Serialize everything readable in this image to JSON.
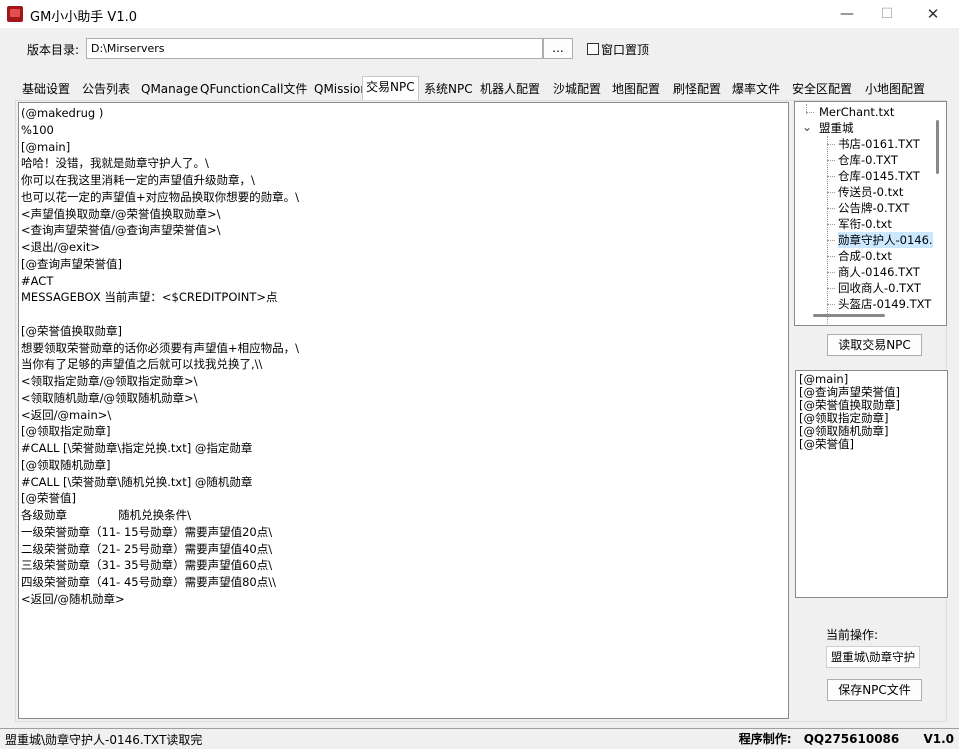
{
  "window": {
    "title": "GM小小助手 V1.0",
    "min_glyph": "—",
    "max_glyph": "☐",
    "close_glyph": "✕"
  },
  "top": {
    "dir_label": "版本目录:",
    "dir_value": "D:\\Mirservers",
    "browse_label": "...",
    "topmost_label": "窗口置顶"
  },
  "tabs": [
    "基础设置",
    "公告列表",
    "QManage",
    "QFunction",
    "Call文件",
    "QMission",
    "交易NPC",
    "系统NPC",
    "机器人配置",
    "沙城配置",
    "地图配置",
    "刷怪配置",
    "爆率文件",
    "安全区配置",
    "小地图配置"
  ],
  "active_tab": "交易NPC",
  "editor_lines": [
    "(@makedrug )",
    "%100",
    "[@main]",
    "哈哈！没错，我就是勋章守护人了。\\",
    "你可以在我这里消耗一定的声望值升级勋章，\\",
    "也可以花一定的声望值+对应物品换取你想要的勋章。\\",
    "<声望值换取勋章/@荣誉值换取勋章>\\",
    "<查询声望荣誉值/@查询声望荣誉值>\\",
    "<退出/@exit>",
    "[@查询声望荣誉值]",
    "#ACT",
    "MESSAGEBOX 当前声望：<$CREDITPOINT>点",
    "",
    "[@荣誉值换取勋章]",
    "想要领取荣誉勋章的话你必须要有声望值+相应物品，\\",
    "当你有了足够的声望值之后就可以找我兑换了,\\\\",
    "<领取指定勋章/@领取指定勋章>\\",
    "<领取随机勋章/@领取随机勋章>\\",
    "<返回/@main>\\",
    "[@领取指定勋章]",
    "#CALL [\\荣誉勋章\\指定兑换.txt] @指定勋章",
    "[@领取随机勋章]",
    "#CALL [\\荣誉勋章\\随机兑换.txt] @随机勋章",
    "[@荣誉值]",
    "各级勋章              随机兑换条件\\",
    "一级荣誉勋章（11- 15号勋章）需要声望值20点\\",
    "二级荣誉勋章（21- 25号勋章）需要声望值40点\\",
    "三级荣誉勋章（31- 35号勋章）需要声望值60点\\",
    "四级荣誉勋章（41- 45号勋章）需要声望值80点\\\\",
    "<返回/@随机勋章>"
  ],
  "tree": {
    "root_file": "MerChant.txt",
    "folder": "盟重城",
    "expand_glyph": "⌄",
    "children": [
      "书店-0161.TXT",
      "仓库-0.TXT",
      "仓库-0145.TXT",
      "传送员-0.txt",
      "公告牌-0.TXT",
      "军衔-0.txt",
      "勋章守护人-0146.",
      "合成-0.txt",
      "商人-0146.TXT",
      "回收商人-0.TXT",
      "头盔店-0149.TXT"
    ],
    "selected_index": 6
  },
  "read_npc_button": "读取交易NPC",
  "labels_list": [
    "[@main]",
    "[@查询声望荣誉值]",
    "[@荣誉值换取勋章]",
    "[@领取指定勋章]",
    "[@领取随机勋章]",
    "[@荣誉值]"
  ],
  "current_op_label": "当前操作:",
  "current_op_value": "盟重城\\勋章守护",
  "save_button": "保存NPC文件",
  "status": {
    "left": "盟重城\\勋章守护人-0146.TXT读取完",
    "right_label": "程序制作:",
    "right_contact": "QQ275610086",
    "version": "V1.0"
  }
}
